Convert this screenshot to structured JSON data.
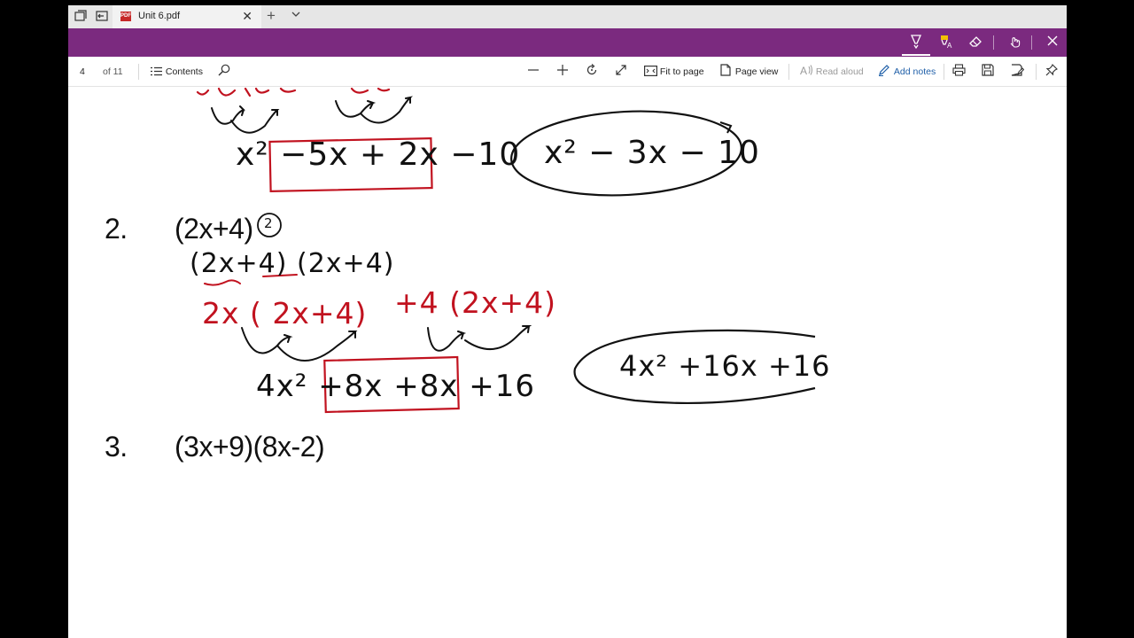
{
  "tabbar": {
    "tab_title": "Unit 6.pdf",
    "pdf_badge": "PDF",
    "icons": [
      "tab-preview-icon",
      "set-aside-tabs-icon",
      "pdf-file-icon",
      "close-icon",
      "new-tab-icon",
      "tab-list-chevron-icon"
    ]
  },
  "inkbar": {
    "color": "#7b2a7f",
    "tools": [
      "ballpoint-pen-icon",
      "highlighter-icon",
      "eraser-icon",
      "touch-writing-icon",
      "close-icon"
    ]
  },
  "toolbar": {
    "page_current": "4",
    "page_total": "of 11",
    "contents_label": "Contents",
    "fit_to_page_label": "Fit to page",
    "page_view_label": "Page view",
    "read_aloud_label": "Read aloud",
    "add_notes_label": "Add notes"
  },
  "document": {
    "p1_work_line": "x² −5x + 2x −10",
    "p1_answer": "x² − 3x − 10",
    "p2_number": "2.",
    "p2_expr": "(2x+4)",
    "p2_exponent": "2",
    "p2_expanded": "(2x+4) (2x+4)",
    "p2_distribute_a": "2x ( 2x+4)",
    "p2_distribute_b": "+4 (2x+4)",
    "p2_work_line": "4x² +8x +8x +16",
    "p2_answer": "4x² +16x +16",
    "p3_number": "3.",
    "p3_expr": "(3x+9)(8x-2)"
  }
}
